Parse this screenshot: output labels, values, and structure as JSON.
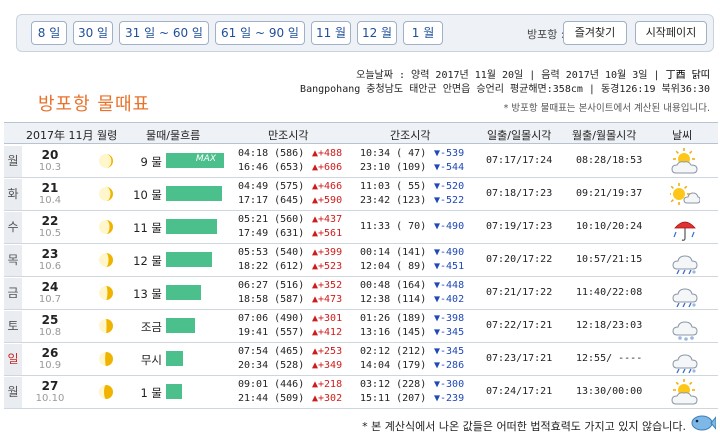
{
  "nav": {
    "buttons": [
      "8 일",
      "30 일",
      "31 일 ~ 60 일",
      "61 일 ~ 90 일",
      "11 월",
      "12 월",
      "1 월"
    ],
    "location_label": "방포항 :",
    "favorites_label": "즐겨찾기",
    "homepage_label": "시작페이지"
  },
  "info": {
    "today": "오늘날짜 : 양력 2017년 11월 20일 | 음력 2017년 10월 3일 |",
    "ganji": "丁酉 닭띠",
    "location": "Bangpohang 충청남도 태안군 안면읍 승언리 평균해면:358cm | 동경126:19 북위36:30"
  },
  "page": {
    "title": "방포항 물때표",
    "notice": "* 방포항 물때표는 본사이트에서 계산된 내용입니다.",
    "footer": "* 본 계산식에서 나온 값들은 어떠한 법적효력도 가지고 있지 않습니다."
  },
  "table": {
    "headers": [
      "2017年 11月 월령",
      "물때/물흐름",
      "만조시각",
      "간조시각",
      "일출/일몰시각",
      "월출/월몰시각",
      "날씨"
    ],
    "rows": [
      {
        "wd": "월",
        "day": "20",
        "lunar": "10.3",
        "moon": 0.12,
        "mul": "9 물",
        "flow": 1.0,
        "max": "MAX",
        "high1": "04:18 (586)",
        "hd1": "▲+488",
        "high2": "16:46 (653)",
        "hd2": "▲+606",
        "low1": "10:34 ( 47)",
        "ld1": "▼-539",
        "low2": "23:10 (109)",
        "ld2": "▼-544",
        "sun": "07:17/17:24",
        "moonrs": "08:28/18:53",
        "weather": "sun-cloud"
      },
      {
        "wd": "화",
        "day": "21",
        "lunar": "10.4",
        "moon": 0.18,
        "mul": "10 물",
        "flow": 0.97,
        "max": "",
        "high1": "04:49 (575)",
        "hd1": "▲+466",
        "high2": "17:17 (645)",
        "hd2": "▲+590",
        "low1": "11:03 ( 55)",
        "ld1": "▼-520",
        "low2": "23:42 (123)",
        "ld2": "▼-522",
        "sun": "07:18/17:23",
        "moonrs": "09:21/19:37",
        "weather": "sun-and-cloud"
      },
      {
        "wd": "수",
        "day": "22",
        "lunar": "10.5",
        "moon": 0.25,
        "mul": "11 물",
        "flow": 0.88,
        "max": "",
        "high1": "05:21 (560)",
        "hd1": "▲+437",
        "high2": "17:49 (631)",
        "hd2": "▲+561",
        "low1": "11:33 ( 70)",
        "ld1": "▼-490",
        "low2": "",
        "ld2": "",
        "sun": "07:19/17:23",
        "moonrs": "10:10/20:24",
        "weather": "umbrella-rain"
      },
      {
        "wd": "목",
        "day": "23",
        "lunar": "10.6",
        "moon": 0.32,
        "mul": "12 물",
        "flow": 0.8,
        "max": "",
        "high1": "05:53 (540)",
        "hd1": "▲+399",
        "high2": "18:22 (612)",
        "hd2": "▲+523",
        "low1": "00:14 (141)",
        "ld1": "▼-490",
        "low2": "12:04 ( 89)",
        "ld2": "▼-451",
        "sun": "07:20/17:22",
        "moonrs": "10:57/21:15",
        "weather": "rain-snow"
      },
      {
        "wd": "금",
        "day": "24",
        "lunar": "10.7",
        "moon": 0.4,
        "mul": "13 물",
        "flow": 0.6,
        "max": "",
        "high1": "06:27 (516)",
        "hd1": "▲+352",
        "high2": "18:58 (587)",
        "hd2": "▲+473",
        "low1": "00:48 (164)",
        "ld1": "▼-448",
        "low2": "12:38 (114)",
        "ld2": "▼-402",
        "sun": "07:21/17:22",
        "moonrs": "11:40/22:08",
        "weather": "rain-snow"
      },
      {
        "wd": "토",
        "day": "25",
        "lunar": "10.8",
        "moon": 0.48,
        "mul": "조금",
        "flow": 0.5,
        "max": "",
        "high1": "07:06 (490)",
        "hd1": "▲+301",
        "high2": "19:41 (557)",
        "hd2": "▲+412",
        "low1": "01:26 (189)",
        "ld1": "▼-398",
        "low2": "13:16 (145)",
        "ld2": "▼-345",
        "sun": "07:22/17:21",
        "moonrs": "12:18/23:03",
        "weather": "snow-cloud"
      },
      {
        "wd": "일",
        "day": "26",
        "lunar": "10.9",
        "moon": 0.56,
        "mul": "무시",
        "flow": 0.3,
        "max": "",
        "high1": "07:54 (465)",
        "hd1": "▲+253",
        "high2": "20:34 (528)",
        "hd2": "▲+349",
        "low1": "02:12 (212)",
        "ld1": "▼-345",
        "low2": "14:04 (179)",
        "ld2": "▼-286",
        "sun": "07:23/17:21",
        "moonrs": "12:55/ ----",
        "weather": "rain-snow"
      },
      {
        "wd": "월",
        "day": "27",
        "lunar": "10.10",
        "moon": 0.64,
        "mul": "1 물",
        "flow": 0.28,
        "max": "",
        "high1": "09:01 (446)",
        "hd1": "▲+218",
        "high2": "21:44 (509)",
        "hd2": "▲+302",
        "low1": "03:12 (228)",
        "ld1": "▼-300",
        "low2": "15:11 (207)",
        "ld2": "▼-239",
        "sun": "07:24/17:21",
        "moonrs": "13:30/00:00",
        "weather": "sun-cloud"
      }
    ]
  }
}
